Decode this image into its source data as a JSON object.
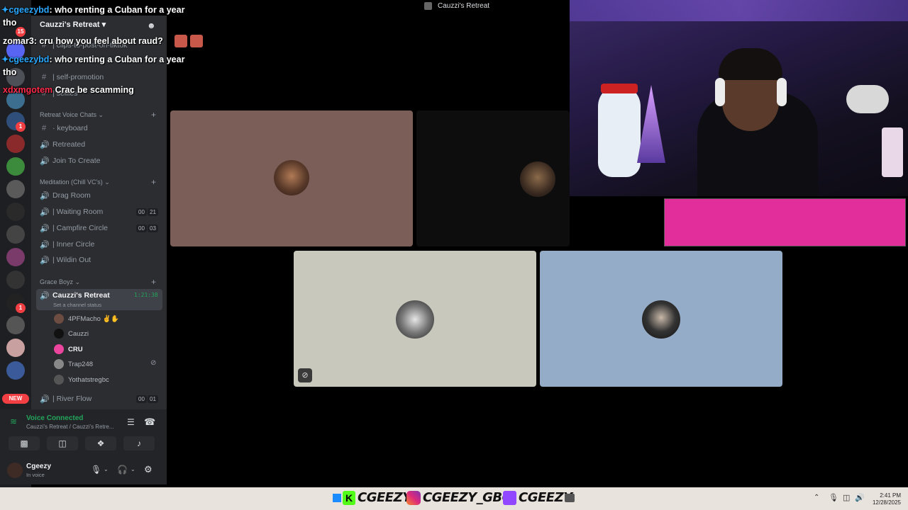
{
  "window_title": "Cauzzi's Retreat",
  "guild_name": "Cauzzi's Retreat",
  "chat": [
    {
      "user": "✦cgeezybd",
      "message": ": who renting a Cuban for a year"
    },
    {
      "user": "tho",
      "message": ""
    },
    {
      "user": "zomar3",
      "message": ": cru how you feel about raud?"
    },
    {
      "user": "✦cgeezybd",
      "message": ": who renting a Cuban for a year"
    },
    {
      "user": "tho",
      "message": ""
    },
    {
      "user": "xdxmgotem",
      "message": "Crac be scamming"
    }
  ],
  "channels_top": [
    {
      "name": "| clips-to-post-on-tiktok"
    },
    {
      "name": "| self-promotion"
    },
    {
      "name": "| selfies"
    }
  ],
  "categories": {
    "voice_chats": "Retreat Voice Chats",
    "meditation": "Meditation (Chill VC's)",
    "grace_boyz": "Grace Boyz"
  },
  "retreat_channels": [
    {
      "name": "· keyboard"
    },
    {
      "name": "Retreated"
    },
    {
      "name": "Join To Create"
    }
  ],
  "meditation_channels": [
    {
      "name": "Drag Room",
      "count1": "",
      "count2": ""
    },
    {
      "name": "| Waiting Room",
      "count1": "00",
      "count2": "21"
    },
    {
      "name": "| Campfire Circle",
      "count1": "00",
      "count2": "03"
    },
    {
      "name": "| Inner Circle",
      "count1": "",
      "count2": ""
    },
    {
      "name": "| Wildin Out",
      "count1": "",
      "count2": ""
    }
  ],
  "active_channel": {
    "name": "Cauzzi's Retreat",
    "timer": "1:21:38",
    "status": "Set a channel status"
  },
  "voice_users": [
    {
      "name": "4PFMacho ✌️✋"
    },
    {
      "name": "Cauzzi"
    },
    {
      "name": "CRU"
    },
    {
      "name": "Trap248"
    },
    {
      "name": "Yothatstregbc"
    }
  ],
  "river_flow": {
    "name": "| River Flow",
    "count1": "00",
    "count2": "01"
  },
  "server_badges": {
    "b1": "15",
    "b2": "1",
    "b3": "1",
    "new": "NEW"
  },
  "voice_panel": {
    "title": "Voice Connected",
    "subtitle": "Cauzzi's Retreat / Cauzzi's Retre...",
    "username": "Cgeezy",
    "user_status": "In voice"
  },
  "socials": [
    {
      "icon": "kick-icon",
      "handle": "CGEEZY"
    },
    {
      "icon": "instagram-icon",
      "handle": "CGEEZY_GBC"
    },
    {
      "icon": "twitch-icon",
      "handle": "CGEEZY"
    }
  ],
  "clock": {
    "time": "2:41 PM",
    "date": "12/28/2025"
  },
  "colors": {
    "tile1": "#7a5e57",
    "tile2": "#0d0d0d",
    "tile3": "#c8c8bc",
    "tile4": "#95acc9",
    "accent_pink": "#e22e9b",
    "voice_green": "#23a55a"
  }
}
